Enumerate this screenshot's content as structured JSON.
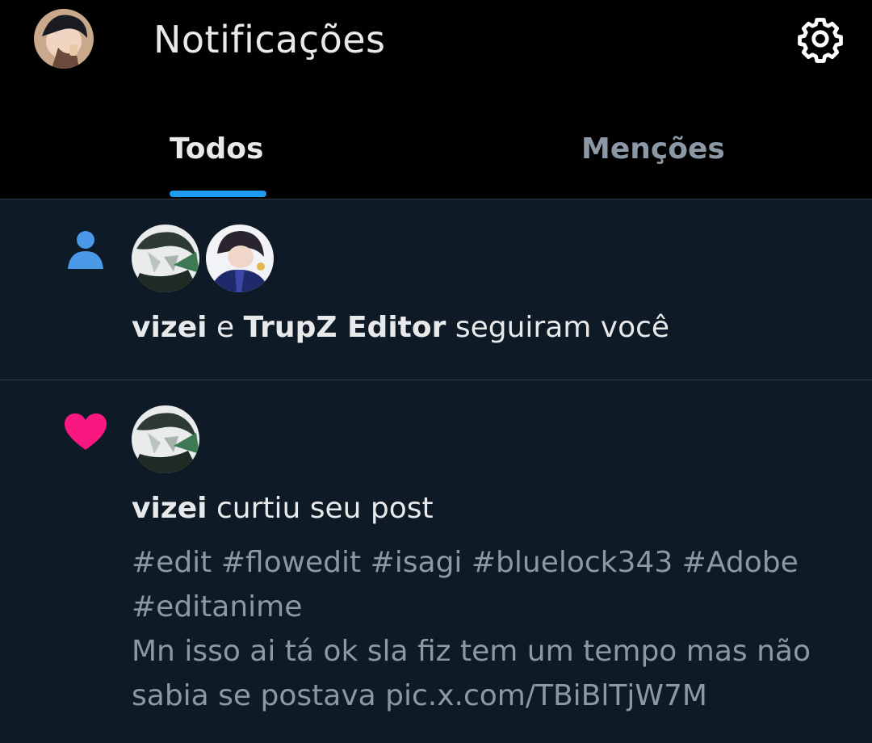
{
  "header": {
    "title": "Notificações",
    "settings_icon": "gear-icon"
  },
  "tabs": [
    {
      "label": "Todos",
      "active": true
    },
    {
      "label": "Menções",
      "active": false
    }
  ],
  "colors": {
    "header_bg": "#000000",
    "feed_bg": "#0e1a25",
    "accent": "#1d9bf0",
    "like": "#f91880",
    "muted_text": "#8b98a5"
  },
  "notifications": [
    {
      "type": "follow",
      "icon": "person-icon",
      "user1": "vizei",
      "conjunction": "e",
      "user2": "TrupZ Editor",
      "action": "seguiram você"
    },
    {
      "type": "like",
      "icon": "heart-icon",
      "user": "vizei",
      "action": "curtiu seu post",
      "post_lines": [
        "#edit #flowedit #isagi #bluelock343 #Adobe",
        "#editanime",
        "Mn isso ai tá ok sla fiz tem um tempo mas não",
        "sabia se postava pic.x.com/TBiBlTjW7M"
      ]
    }
  ]
}
